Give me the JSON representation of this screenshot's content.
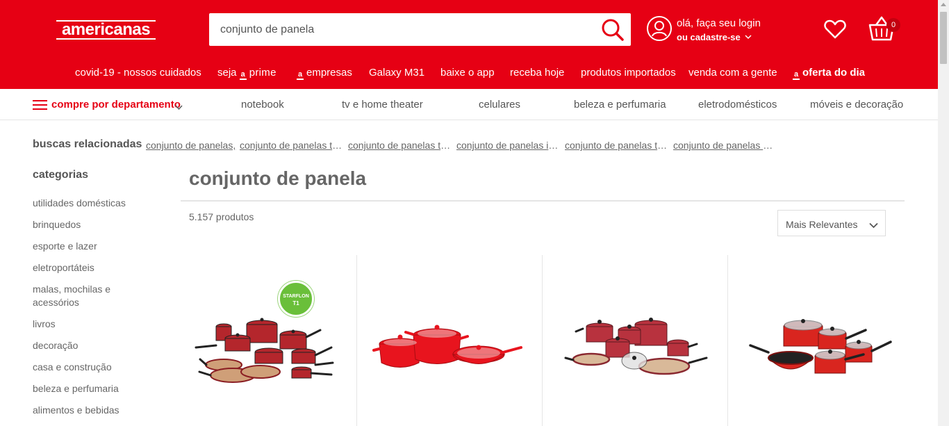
{
  "header": {
    "logo": "americanas",
    "search": {
      "value": "conjunto de panela",
      "icon": "search-icon"
    },
    "account": {
      "line1": "olá, faça seu login",
      "line2": "ou cadastre-se"
    },
    "cart": {
      "count": "0"
    }
  },
  "topnav": {
    "items": [
      "covid-19 - nossos cuidados",
      "seja",
      "prime",
      "empresas",
      "Galaxy M31",
      "baixe o app",
      "receba hoje",
      "produtos importados",
      "venda com a gente",
      "oferta do dia"
    ],
    "brand_mark": "a"
  },
  "departments": {
    "trigger": "compre por departamento",
    "items": [
      "notebook",
      "tv e home theater",
      "celulares",
      "beleza e perfumaria",
      "eletrodomésticos",
      "móveis e decoração"
    ]
  },
  "related": {
    "label": "buscas relacionadas",
    "links": [
      "conjunto de panelas,",
      "conjunto de panelas tramontina",
      "conjunto de panelas tramontina antiaderente",
      "conjunto de panelas inox",
      "conjunto de panelas tramontina inox",
      "conjunto de panelas antiaderente"
    ]
  },
  "sidebar": {
    "title": "categorias",
    "items": [
      "utilidades domésticas",
      "brinquedos",
      "esporte e lazer",
      "eletroportáteis",
      "malas, mochilas e acessórios",
      "livros",
      "decoração",
      "casa e construção",
      "beleza e perfumaria",
      "alimentos e bebidas"
    ]
  },
  "main": {
    "title": "conjunto de panela",
    "count": "5.157 produtos",
    "sort": "Mais Relevantes"
  },
  "products": [
    {
      "badge_line1": "STARFLON",
      "badge_line2": "T1",
      "color": "#b4262c"
    },
    {
      "color": "#e8141e"
    },
    {
      "color": "#b8323e"
    },
    {
      "color": "#d9251f"
    }
  ],
  "colors": {
    "brand": "#e60014"
  }
}
